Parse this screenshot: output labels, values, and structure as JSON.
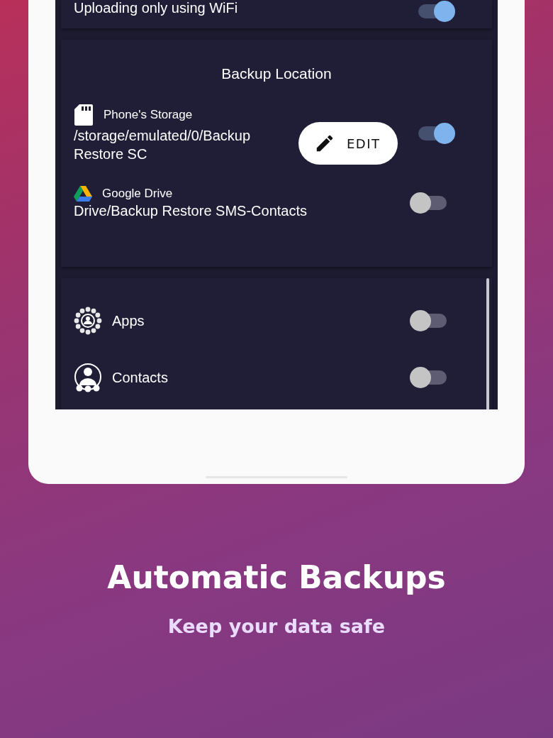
{
  "top_setting": {
    "label": "Uploading only using WiFi",
    "on": true
  },
  "backup_location": {
    "title": "Backup Location",
    "items": [
      {
        "kind": "storage",
        "name": "Phone's Storage",
        "path": "/storage/emulated/0/Backup Restore SC",
        "on": true
      },
      {
        "kind": "drive",
        "name": "Google Drive",
        "path": "Drive/Backup Restore SMS-Contacts",
        "on": false
      }
    ],
    "edit_button": "EDIT"
  },
  "backup_items": [
    {
      "kind": "apps",
      "label": "Apps",
      "on": false
    },
    {
      "kind": "contacts",
      "label": "Contacts",
      "on": false
    }
  ],
  "headline": "Automatic Backups",
  "subtitle": "Keep your data safe"
}
